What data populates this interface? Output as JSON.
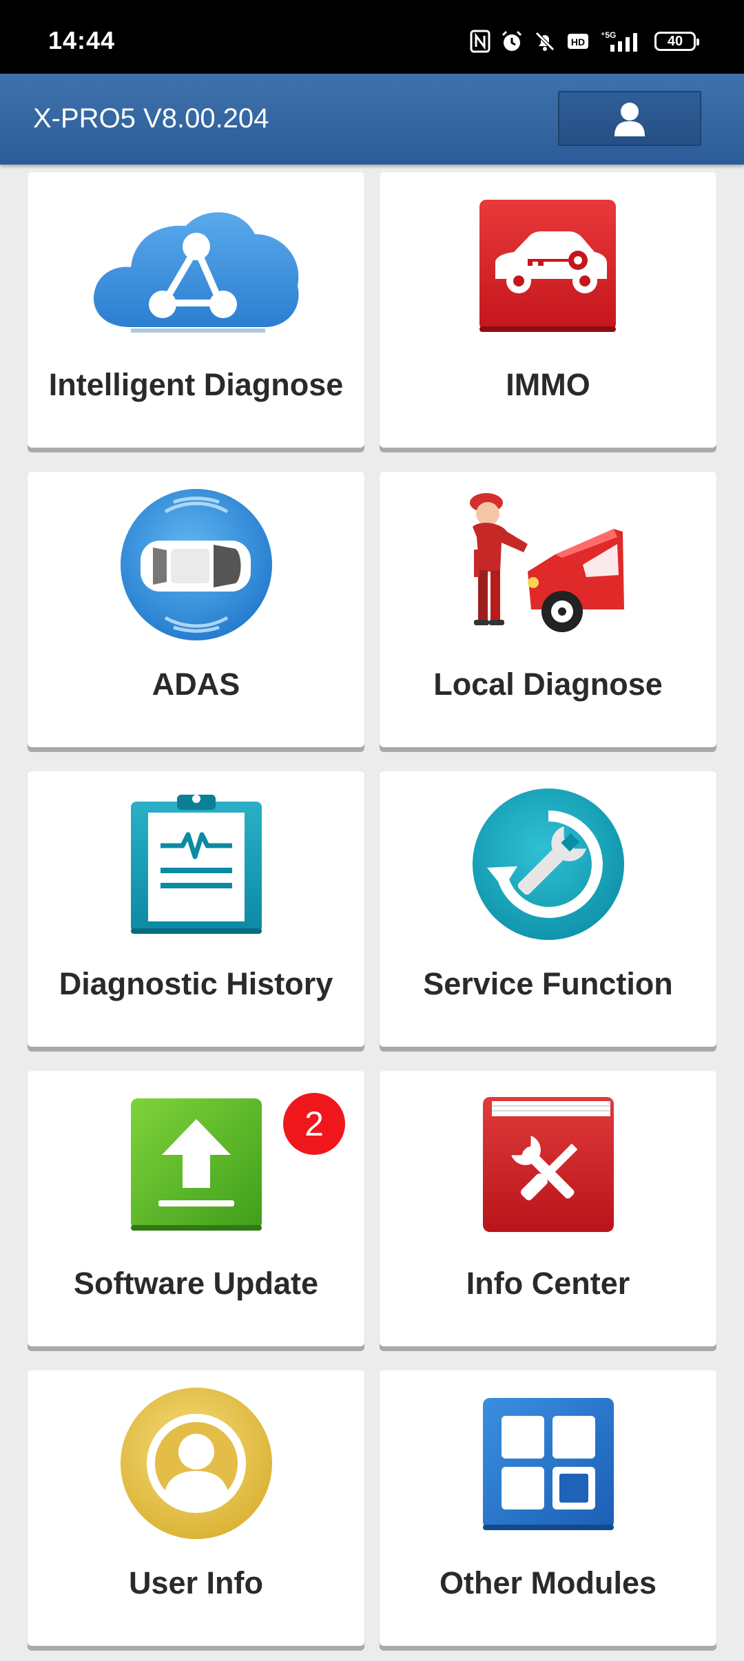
{
  "status_bar": {
    "time": "14:44",
    "battery": "40",
    "icons": [
      "nfc-icon",
      "alarm-icon",
      "mute-icon",
      "hd-icon",
      "5g-signal-icon",
      "battery-icon"
    ]
  },
  "app_bar": {
    "title": "X-PRO5 V8.00.204",
    "user_icon": "user-icon"
  },
  "tiles": [
    {
      "label": "Intelligent Diagnose",
      "icon": "cloud-network-icon"
    },
    {
      "label": "IMMO",
      "icon": "car-key-icon"
    },
    {
      "label": "ADAS",
      "icon": "adas-car-icon"
    },
    {
      "label": "Local Diagnose",
      "icon": "mechanic-icon"
    },
    {
      "label": "Diagnostic History",
      "icon": "clipboard-icon"
    },
    {
      "label": "Service Function",
      "icon": "wrench-refresh-icon"
    },
    {
      "label": "Software Update",
      "icon": "upload-icon",
      "badge": "2"
    },
    {
      "label": "Info Center",
      "icon": "tools-book-icon"
    },
    {
      "label": "User Info",
      "icon": "user-circle-icon"
    },
    {
      "label": "Other Modules",
      "icon": "modules-grid-icon"
    }
  ],
  "colors": {
    "app_bar": "#2f609c",
    "badge": "#f0171c",
    "background": "#ececec"
  }
}
